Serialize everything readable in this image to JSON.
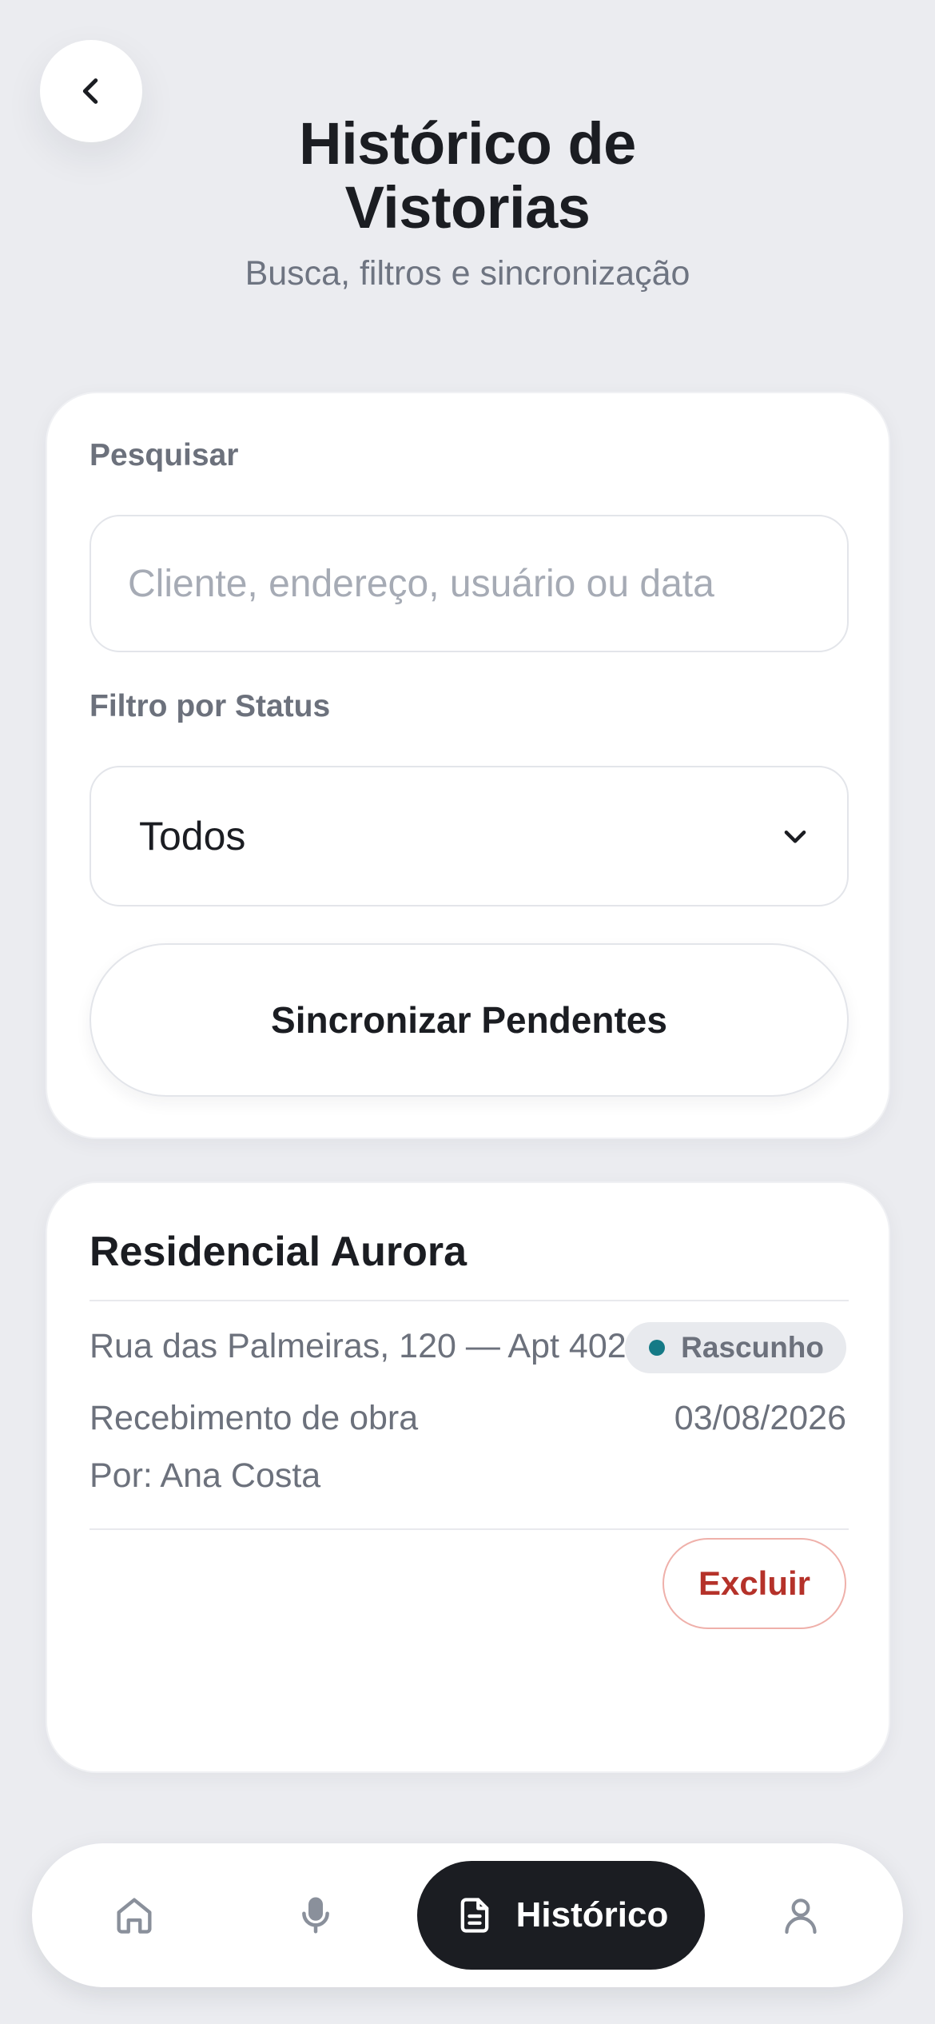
{
  "header": {
    "back_icon": "chevron-left-icon",
    "title": "Histórico de Vistorias",
    "subtitle": "Busca, filtros e sincronização"
  },
  "filters": {
    "search_label": "Pesquisar",
    "search_placeholder": "Cliente, endereço, usuário ou data",
    "search_value": "",
    "status_label": "Filtro por Status",
    "status_selected": "Todos",
    "status_icon": "chevron-down-icon",
    "sync_button_label": "Sincronizar Pendentes"
  },
  "inspections": [
    {
      "title": "Residencial Aurora",
      "address": "Rua das Palmeiras, 120 — Apt 402",
      "status": "Rascunho",
      "type": "Recebimento de obra",
      "date": "03/08/2026",
      "author": "Por: Ana Costa",
      "delete_label": "Excluir"
    }
  ],
  "bottom_nav": {
    "items": [
      {
        "id": "home",
        "icon": "home-icon",
        "label": "",
        "active": false
      },
      {
        "id": "voice",
        "icon": "microphone-icon",
        "label": "",
        "active": false
      },
      {
        "id": "history",
        "icon": "document-icon",
        "label": "Histórico",
        "active": true
      },
      {
        "id": "profile",
        "icon": "user-icon",
        "label": "",
        "active": false
      }
    ]
  },
  "colors": {
    "background": "#ebecf0",
    "surface": "#ffffff",
    "text_primary": "#1b1d22",
    "text_secondary": "#6c717c",
    "active_nav": "#1b1d22",
    "status_dot_draft": "#157a86",
    "danger": "#b5322a",
    "danger_border": "#efb0aa"
  }
}
